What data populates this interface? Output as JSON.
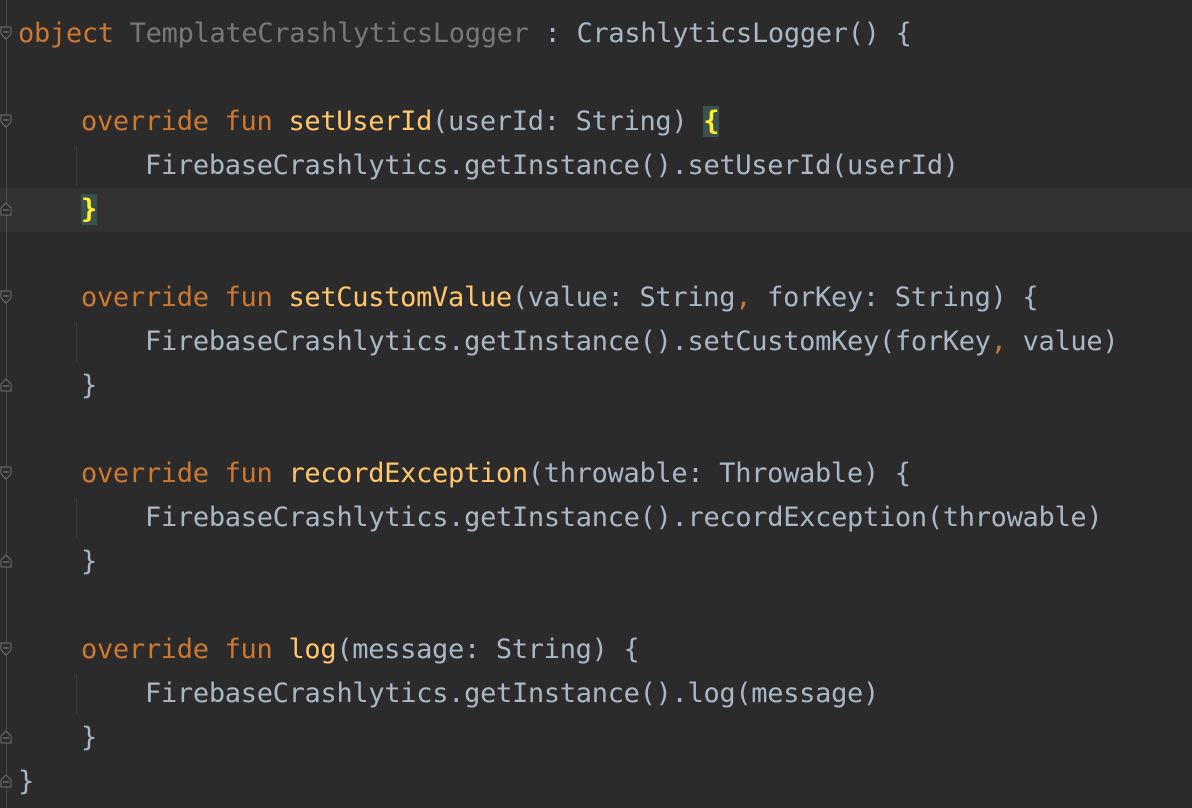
{
  "colors": {
    "background": "#2b2b2b",
    "current_line": "#323232",
    "keyword": "#cc7832",
    "function_name": "#ffc66d",
    "text": "#a9b7c6",
    "unused_object_name": "#787878",
    "matched_brace": "#ffef28",
    "matched_brace_background": "#3b514d"
  },
  "icons": {
    "fold": "fold-marker-icon"
  },
  "code": {
    "l1": {
      "kw": "object",
      "sp": " ",
      "name": "TemplateCrashlyticsLogger",
      "rest": " : CrashlyticsLogger() {"
    },
    "l3": {
      "kw": "override fun",
      "sp": " ",
      "fn": "setUserId",
      "p1": "(userId: String) ",
      "brace": "{"
    },
    "l4": {
      "text": "FirebaseCrashlytics.getInstance().setUserId(userId)"
    },
    "l5": {
      "brace": "}"
    },
    "l7": {
      "kw": "override fun",
      "sp": " ",
      "fn": "setCustomValue",
      "p1": "(value: String",
      "comma": ",",
      "p2": " forKey: String) {"
    },
    "l8": {
      "p1": "FirebaseCrashlytics.getInstance().setCustomKey(forKey",
      "comma": ",",
      "p2": " value)"
    },
    "l9": {
      "text": "}"
    },
    "l11": {
      "kw": "override fun",
      "sp": " ",
      "fn": "recordException",
      "p1": "(throwable: Throwable) {"
    },
    "l12": {
      "text": "FirebaseCrashlytics.getInstance().recordException(throwable)"
    },
    "l13": {
      "text": "}"
    },
    "l15": {
      "kw": "override fun",
      "sp": " ",
      "fn": "log",
      "p1": "(message: String) {"
    },
    "l16": {
      "text": "FirebaseCrashlytics.getInstance().log(message)"
    },
    "l17": {
      "text": "}"
    },
    "l18": {
      "text": "}"
    }
  }
}
